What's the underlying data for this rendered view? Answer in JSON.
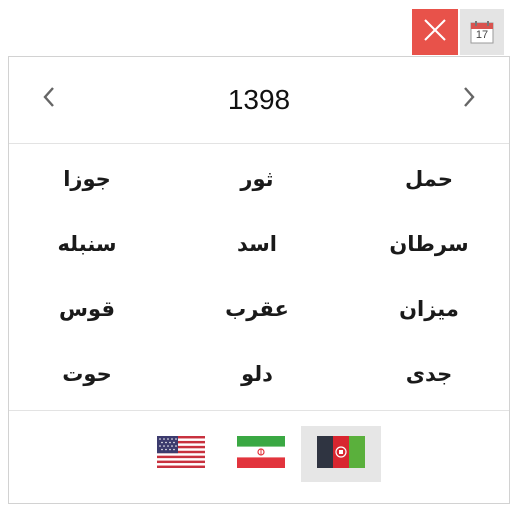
{
  "calendar_icon": {
    "day": "17"
  },
  "header": {
    "year": "1398"
  },
  "months": [
    "حمل",
    "ثور",
    "جوزا",
    "سرطان",
    "اسد",
    "سنبله",
    "میزان",
    "عقرب",
    "قوس",
    "جدی",
    "دلو",
    "حوت"
  ],
  "footer": {
    "active_locale": "afghanistan"
  },
  "colors": {
    "close": "#e8524a",
    "calendar_red": "#d9534f"
  }
}
